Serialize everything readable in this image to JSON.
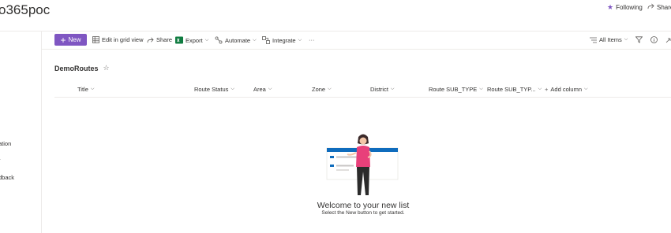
{
  "site": {
    "title": "o365poc"
  },
  "header": {
    "following_label": "Following",
    "share_label": "Share"
  },
  "nav": {
    "items": [
      "ation",
      "r",
      "dback"
    ]
  },
  "commandbar": {
    "new_label": "New",
    "edit_grid_label": "Edit in grid view",
    "share_label": "Share",
    "export_label": "Export",
    "automate_label": "Automate",
    "integrate_label": "Integrate",
    "more_label": "···",
    "view_label": "All Items"
  },
  "list": {
    "title": "DemoRoutes",
    "columns": [
      "Title",
      "Route Status",
      "Area",
      "Zone",
      "District",
      "Route SUB_TYPE",
      "Route SUB_TYP..."
    ],
    "add_column_label": "Add column"
  },
  "empty_state": {
    "title": "Welcome to your new list",
    "subtitle": "Select the New button to get started."
  },
  "colors": {
    "accent": "#7f56c2",
    "excel": "#107c41",
    "blue": "#0f6cbd"
  }
}
